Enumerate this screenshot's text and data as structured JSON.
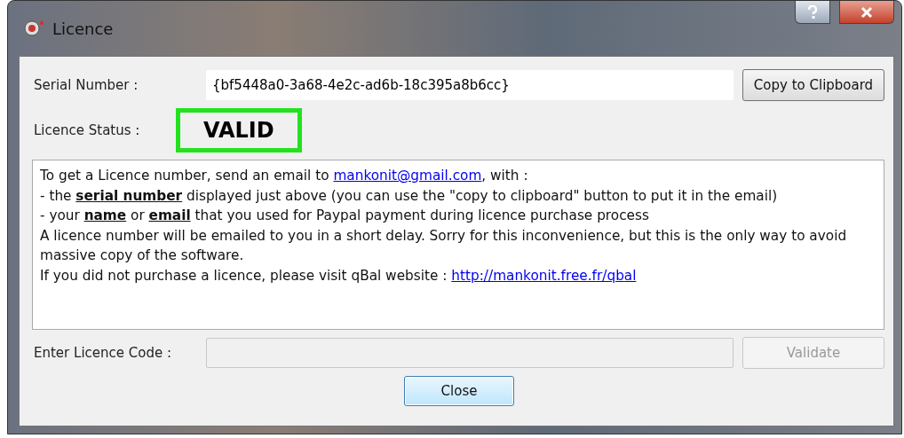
{
  "window": {
    "title": "Licence"
  },
  "serial": {
    "label": "Serial Number :",
    "value": "{bf5448a0-3a68-4e2c-ad6b-18c395a8b6cc}",
    "button": "Copy to Clipboard"
  },
  "status": {
    "label": "Licence Status :",
    "value": "VALID",
    "highlighted": true
  },
  "info": [
    [
      {
        "text": "To get a Licence number, send an email to "
      },
      {
        "text": "mankonit@gmail.com",
        "kind": "link"
      },
      {
        "text": ", with :"
      }
    ],
    [
      {
        "text": "- the **serial number** displayed just above (you can use the \"copy to clipboard\" button to put it in the email)"
      }
    ],
    [
      {
        "text": "- your **name** or **email** that you used for Paypal payment during licence purchase process"
      }
    ],
    [
      {
        "text": "A licence number will be emailed to you in a short delay. Sorry for this inconvenience, but this is the only way to avoid massive copy of the software."
      }
    ],
    [
      {
        "text": "If you did not purchase a licence, please visit qBal website : "
      },
      {
        "text": "http://mankonit.free.fr/qbal",
        "kind": "link"
      }
    ]
  ],
  "code": {
    "label": "Enter Licence Code :",
    "disabled": true,
    "button": "Validate",
    "button_disabled": true
  },
  "close": "Close"
}
